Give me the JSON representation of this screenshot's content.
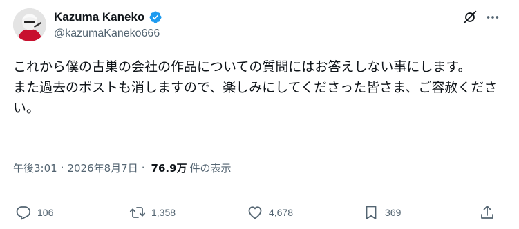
{
  "author": {
    "display_name": "Kazuma Kaneko",
    "handle": "@kazumaKaneko666",
    "verified": true,
    "verified_color": "#1d9bf0"
  },
  "header_icons": [
    "grok-icon",
    "more-icon"
  ],
  "tweet": {
    "line1": "これから僕の古巣の会社の作品についての質問にはお答えしない事にします。",
    "line2": "また過去のポストも消しますので、楽しみにしてくださった皆さま、ご容赦ください。"
  },
  "meta": {
    "time": "午後3:01",
    "separator": "·",
    "date": "2026年8月7日",
    "views": "76.9万",
    "views_label": "件の表示"
  },
  "actions": {
    "replies": "106",
    "reposts": "1,358",
    "likes": "4,678",
    "bookmarks": "369"
  },
  "colors": {
    "text": "#0f1419",
    "secondary": "#536471",
    "accent": "#1d9bf0"
  }
}
